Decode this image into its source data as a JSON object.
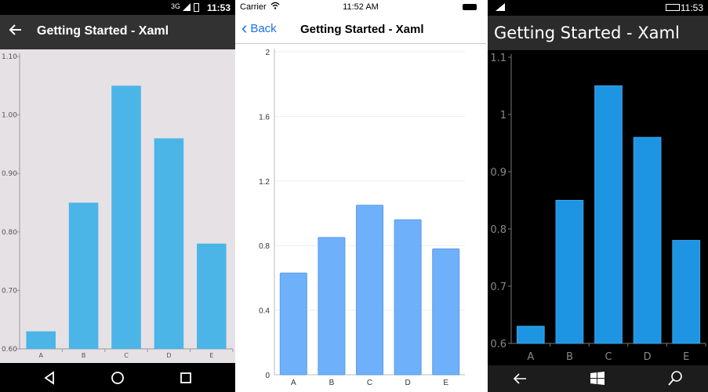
{
  "android": {
    "status": {
      "time": "11:53",
      "signal_label": "3G"
    },
    "app_title": "Getting Started - Xaml",
    "icons": {
      "back": "back-arrow-icon",
      "nav_back": "nav-back-icon",
      "nav_home": "nav-home-icon",
      "nav_recents": "nav-recents-icon"
    },
    "colors": {
      "bar": "#4bb5e8",
      "background": "#e6e1e5",
      "appbar": "#323232"
    }
  },
  "ios": {
    "status": {
      "carrier": "Carrier",
      "time": "11:52 AM"
    },
    "back_label": "Back",
    "nav_title": "Getting Started - Xaml",
    "icons": {
      "back": "chevron-left-icon",
      "wifi": "wifi-icon",
      "battery": "battery-icon"
    },
    "colors": {
      "bar": "#6fb0fb",
      "accent": "#1a73e8"
    }
  },
  "windows": {
    "status": {
      "time": "11:53"
    },
    "app_title": "Getting Started - Xaml",
    "icons": {
      "back": "back-arrow-icon",
      "start": "windows-start-icon",
      "search": "search-icon"
    },
    "colors": {
      "bar": "#1e95e2",
      "background": "#000000"
    }
  },
  "chart_data": [
    {
      "type": "bar",
      "categories": [
        "A",
        "B",
        "C",
        "D",
        "E"
      ],
      "values": [
        0.63,
        0.85,
        1.05,
        0.96,
        0.78
      ],
      "ylim": [
        0.6,
        1.1
      ],
      "yticks": [
        "0.60",
        "0.70",
        "0.80",
        "0.90",
        "1.00",
        "1.10"
      ],
      "grid": false
    },
    {
      "type": "bar",
      "categories": [
        "A",
        "B",
        "C",
        "D",
        "E"
      ],
      "values": [
        0.63,
        0.85,
        1.05,
        0.96,
        0.78
      ],
      "ylim": [
        0,
        2
      ],
      "yticks": [
        "0",
        "0.4",
        "0.8",
        "1.2",
        "1.6",
        "2"
      ],
      "grid": true
    },
    {
      "type": "bar",
      "categories": [
        "A",
        "B",
        "C",
        "D",
        "E"
      ],
      "values": [
        0.63,
        0.85,
        1.05,
        0.96,
        0.78
      ],
      "ylim": [
        0.6,
        1.1
      ],
      "yticks": [
        "0.6",
        "0.7",
        "0.8",
        "0.9",
        "1",
        "1.1"
      ],
      "grid": false
    }
  ]
}
